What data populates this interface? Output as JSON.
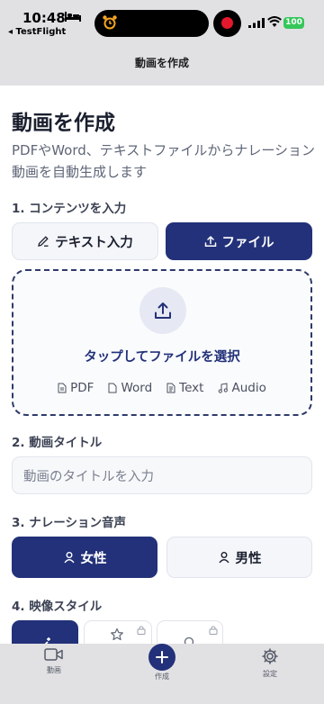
{
  "status": {
    "time": "10:48",
    "back_label": "◂ TestFlight",
    "battery": "100"
  },
  "nav": {
    "title": "動画を作成"
  },
  "page": {
    "title": "動画を作成",
    "subtitle": "PDFやWord、テキストファイルからナレーション動画を自動生成します"
  },
  "content_section": {
    "label": "1. コンテンツを入力",
    "text_button": "テキスト入力",
    "file_button": "ファイル",
    "drop_title": "タップしてファイルを選択",
    "file_types": [
      "PDF",
      "Word",
      "Text",
      "Audio"
    ]
  },
  "title_section": {
    "label": "2. 動画タイトル",
    "placeholder": "動画のタイトルを入力"
  },
  "voice_section": {
    "label": "3. ナレーション音声",
    "female": "女性",
    "male": "男性"
  },
  "style_section": {
    "label": "4. 映像スタイル"
  },
  "tabbar": {
    "videos": "動画",
    "create": "作成",
    "settings": "設定"
  },
  "colors": {
    "primary": "#223179",
    "recording": "#e3182d",
    "battery": "#34c759"
  }
}
